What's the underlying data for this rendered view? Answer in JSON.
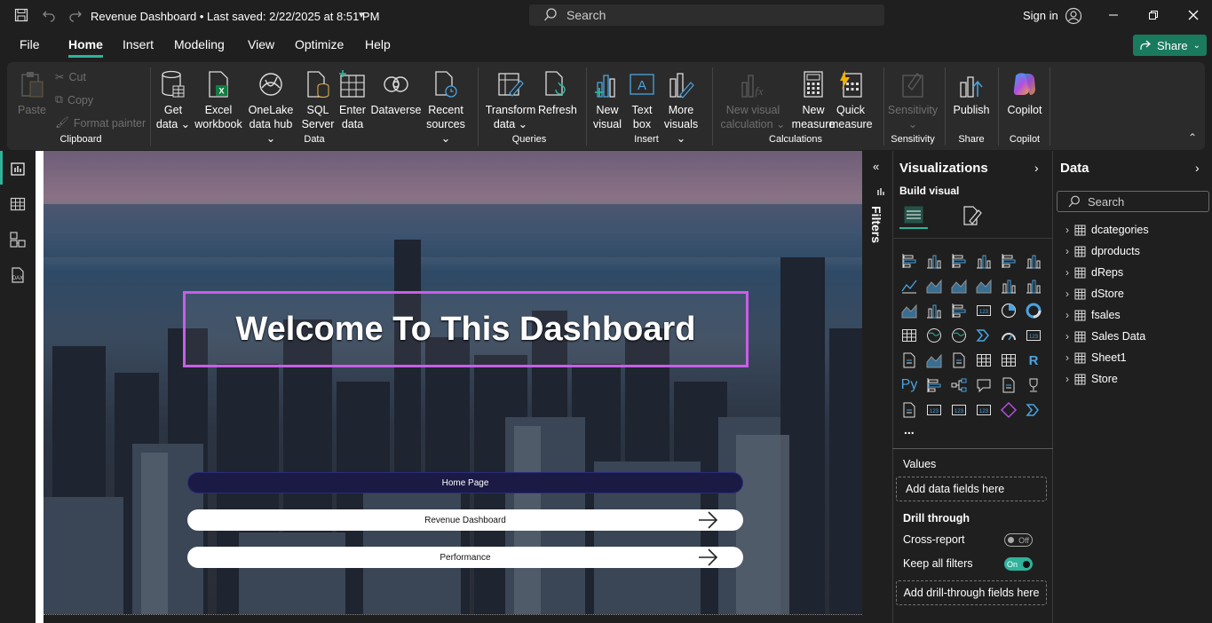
{
  "titlebar": {
    "title": "Revenue Dashboard • Last saved: 2/22/2025 at 8:51 PM",
    "search_placeholder": "Search",
    "signin": "Sign in"
  },
  "menu": {
    "items": [
      "File",
      "Home",
      "Insert",
      "Modeling",
      "View",
      "Optimize",
      "Help"
    ],
    "active": "Home",
    "share_label": "Share"
  },
  "ribbon": {
    "clipboard": {
      "paste": "Paste",
      "cut": "Cut",
      "copy": "Copy",
      "format_painter": "Format painter",
      "group": "Clipboard"
    },
    "data": {
      "get_data": [
        "Get",
        "data ⌄"
      ],
      "excel": [
        "Excel",
        "workbook"
      ],
      "onelake": [
        "OneLake",
        "data hub ⌄"
      ],
      "sql": [
        "SQL",
        "Server"
      ],
      "enter": [
        "Enter",
        "data"
      ],
      "dataverse": [
        "Dataverse",
        ""
      ],
      "recent": [
        "Recent",
        "sources ⌄"
      ],
      "group": "Data"
    },
    "queries": {
      "transform": [
        "Transform",
        "data ⌄"
      ],
      "refresh": [
        "Refresh",
        ""
      ],
      "group": "Queries"
    },
    "insert": {
      "new_visual": [
        "New",
        "visual"
      ],
      "text_box": [
        "Text",
        "box"
      ],
      "more_visuals": [
        "More",
        "visuals ⌄"
      ],
      "group": "Insert"
    },
    "calculations": {
      "new_visual_calc": [
        "New visual",
        "calculation ⌄"
      ],
      "new_measure": [
        "New",
        "measure"
      ],
      "quick_measure": [
        "Quick",
        "measure"
      ],
      "group": "Calculations"
    },
    "sensitivity": {
      "label": [
        "Sensitivity",
        "⌄"
      ],
      "group": "Sensitivity"
    },
    "share": {
      "publish": "Publish",
      "group": "Share"
    },
    "copilot": {
      "label": "Copilot",
      "group": "Copilot"
    }
  },
  "canvas": {
    "welcome": "Welcome To This Dashboard",
    "buttons": [
      "Home Page",
      "Revenue Dashboard",
      "Performance"
    ]
  },
  "filters": {
    "label": "Filters"
  },
  "visualizations": {
    "title": "Visualizations",
    "build_visual": "Build visual",
    "more": "...",
    "values_label": "Values",
    "add_data_fields": "Add data fields here",
    "drill_through": "Drill through",
    "cross_report": "Cross-report",
    "cross_report_state": "Off",
    "keep_all_filters": "Keep all filters",
    "keep_all_filters_state": "On",
    "add_drill_fields": "Add drill-through fields here"
  },
  "data_pane": {
    "title": "Data",
    "search_placeholder": "Search",
    "tables": [
      "dcategories",
      "dproducts",
      "dReps",
      "dStore",
      "fsales",
      "Sales Data",
      "Sheet1",
      "Store"
    ]
  },
  "colors": {
    "accent": "#2fb39b",
    "share": "#1a7a5e",
    "welcome_border": "#c85ee8",
    "toggle_on": "#2fb39b"
  }
}
